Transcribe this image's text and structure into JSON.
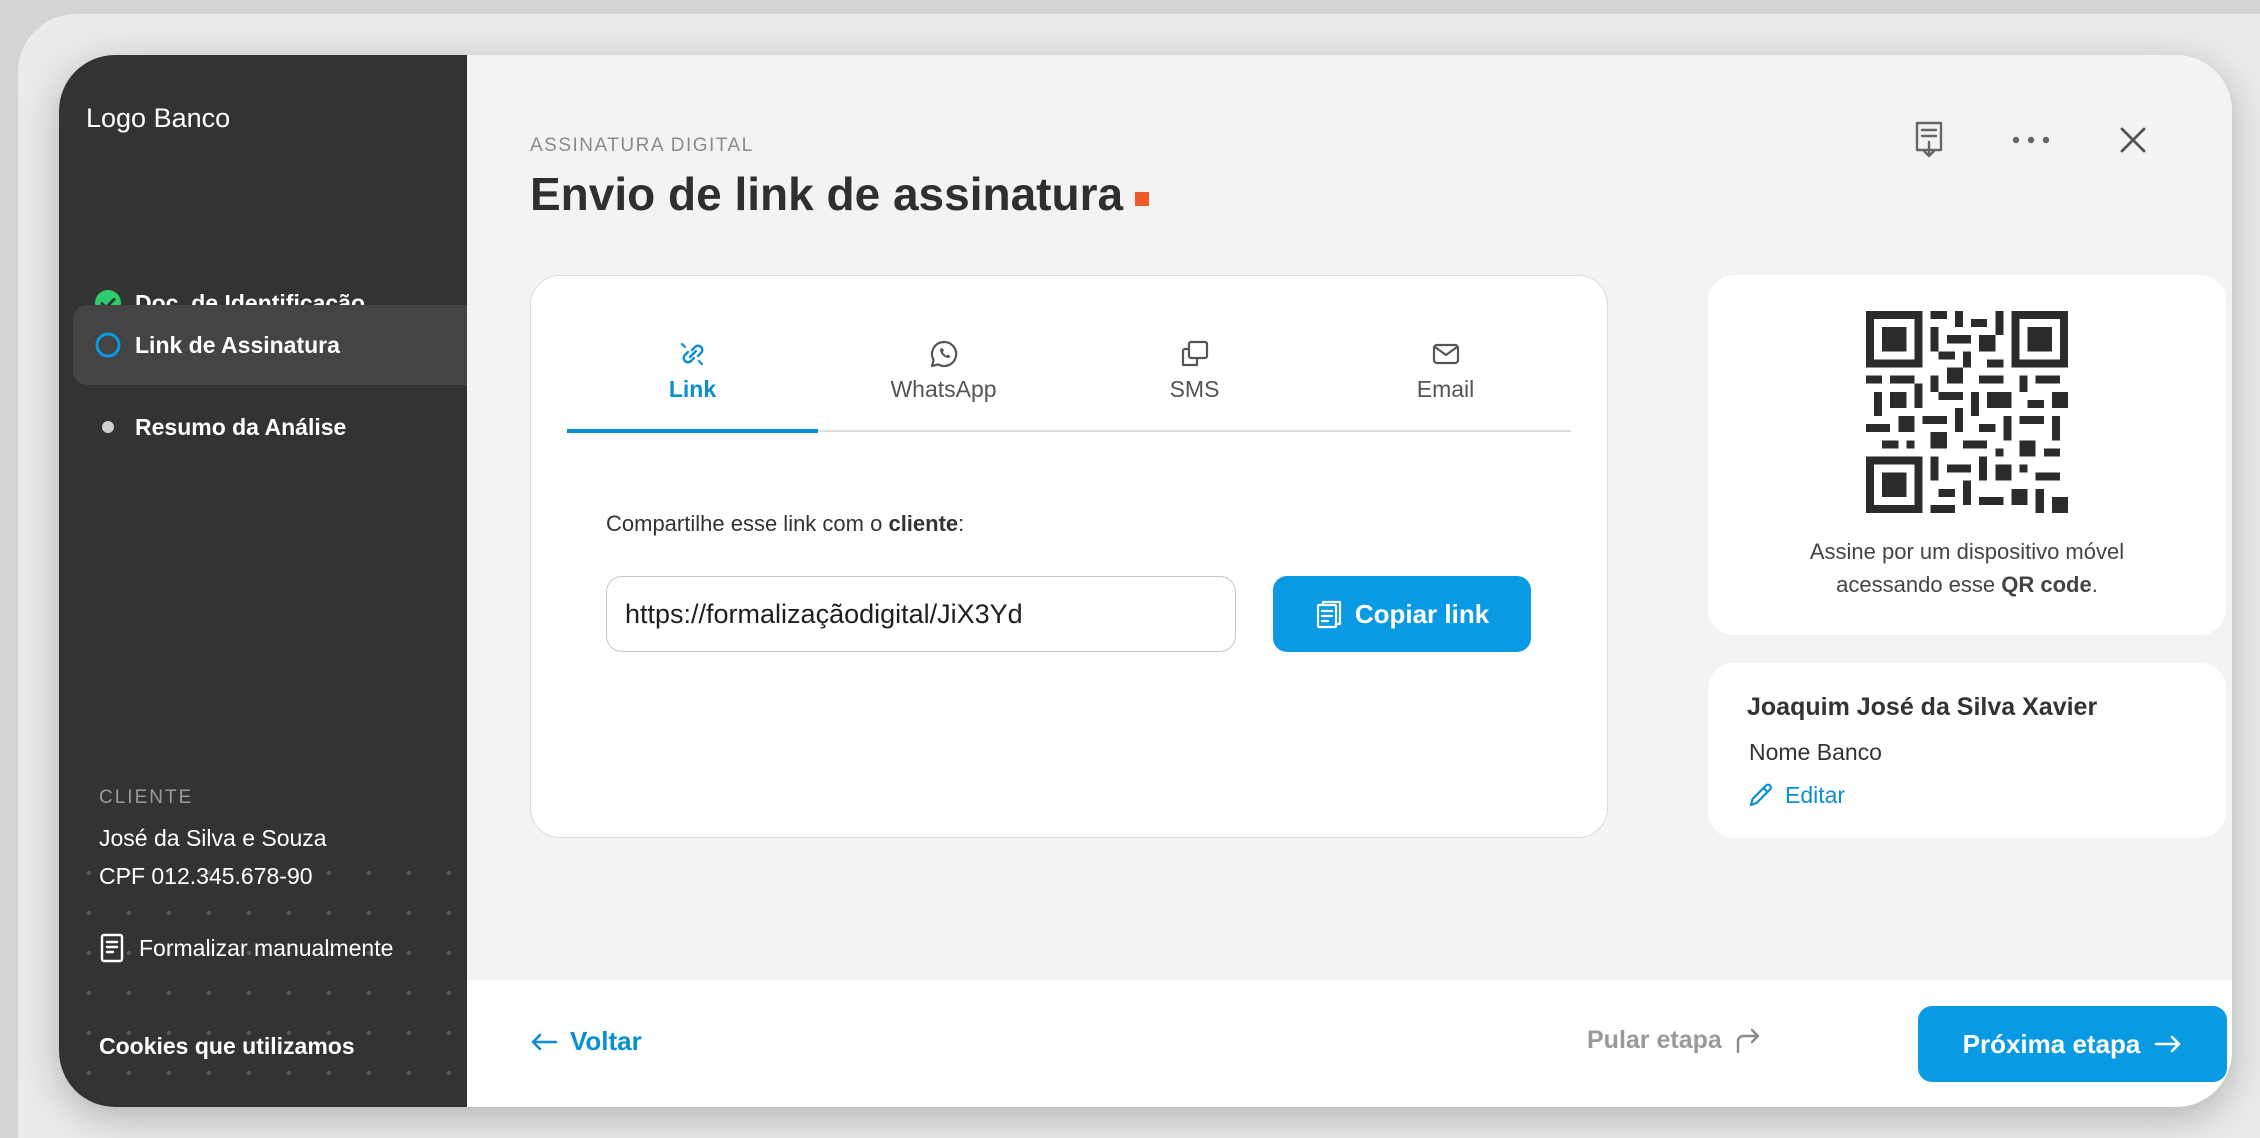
{
  "sidebar": {
    "logo": "Logo Banco",
    "steps": [
      {
        "label": "Doc. de Identificação",
        "state": "done"
      },
      {
        "label": "Link de Assinatura",
        "state": "current"
      },
      {
        "label": "Resumo da Análise",
        "state": "pending"
      }
    ],
    "client_label": "CLIENTE",
    "client_name": "José da Silva e Souza",
    "client_cpf": "CPF 012.345.678-90",
    "manual_label": "Formalizar manualmente",
    "cookies_label": "Cookies que utilizamos"
  },
  "header": {
    "eyebrow": "ASSINATURA DIGITAL",
    "title": "Envio de link de assinatura",
    "accent_color": "#f05a28",
    "actions": [
      "download-doc-icon",
      "more-icon",
      "close-icon"
    ]
  },
  "tabs": [
    {
      "label": "Link",
      "icon": "link-icon",
      "active": true
    },
    {
      "label": "WhatsApp",
      "icon": "whatsapp-icon",
      "active": false
    },
    {
      "label": "SMS",
      "icon": "sms-icon",
      "active": false
    },
    {
      "label": "Email",
      "icon": "email-icon",
      "active": false
    }
  ],
  "share": {
    "text_prefix": "Compartilhe esse link com o ",
    "text_bold": "cliente",
    "text_suffix": ":",
    "link_value": "https://formalizaçãodigital/JiX3Yd",
    "copy_label": "Copiar link"
  },
  "qr": {
    "text_line1": "Assine por um dispositivo móvel",
    "text_prefix": "acessando esse ",
    "text_bold": "QR code",
    "text_suffix": "."
  },
  "person": {
    "name": "Joaquim José da Silva Xavier",
    "bank": "Nome Banco",
    "edit_label": "Editar"
  },
  "footer": {
    "back_label": "Voltar",
    "skip_label": "Pular etapa",
    "next_label": "Próxima etapa"
  },
  "colors": {
    "primary": "#0a9ae3",
    "success": "#2ecc71",
    "sidebar_bg": "#333333"
  }
}
